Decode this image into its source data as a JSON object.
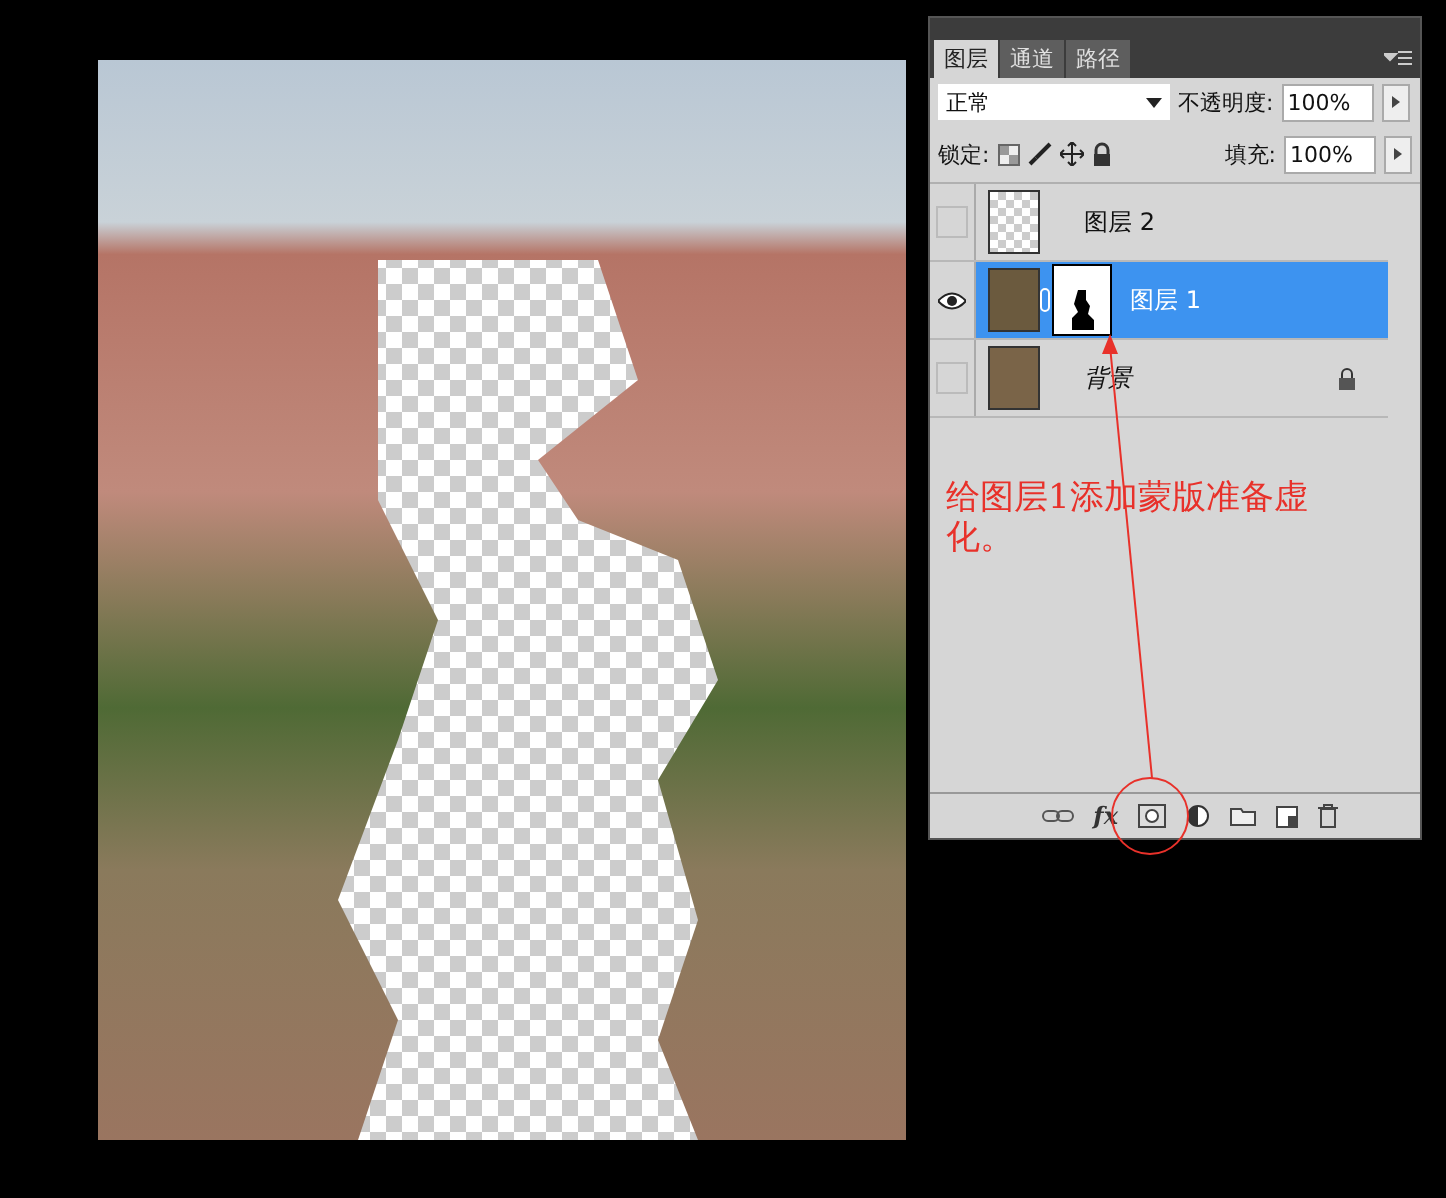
{
  "tabs": [
    {
      "label": "图层",
      "selected": true
    },
    {
      "label": "通道",
      "selected": false
    },
    {
      "label": "路径",
      "selected": false
    }
  ],
  "blend_mode": "正常",
  "opacity": {
    "label": "不透明度:",
    "value": "100%"
  },
  "lock": {
    "label": "锁定:"
  },
  "fill": {
    "label": "填充:",
    "value": "100%"
  },
  "layers": [
    {
      "name": "图层 2",
      "kind": "layer",
      "visible": false,
      "selected": false
    },
    {
      "name": "图层 1",
      "kind": "masked",
      "visible": true,
      "selected": true
    },
    {
      "name": "背景",
      "kind": "background",
      "visible": false,
      "selected": false
    }
  ],
  "annotation": "给图层1添加蒙版准备虚化。",
  "toolbar": {
    "fx_label": "fx"
  }
}
